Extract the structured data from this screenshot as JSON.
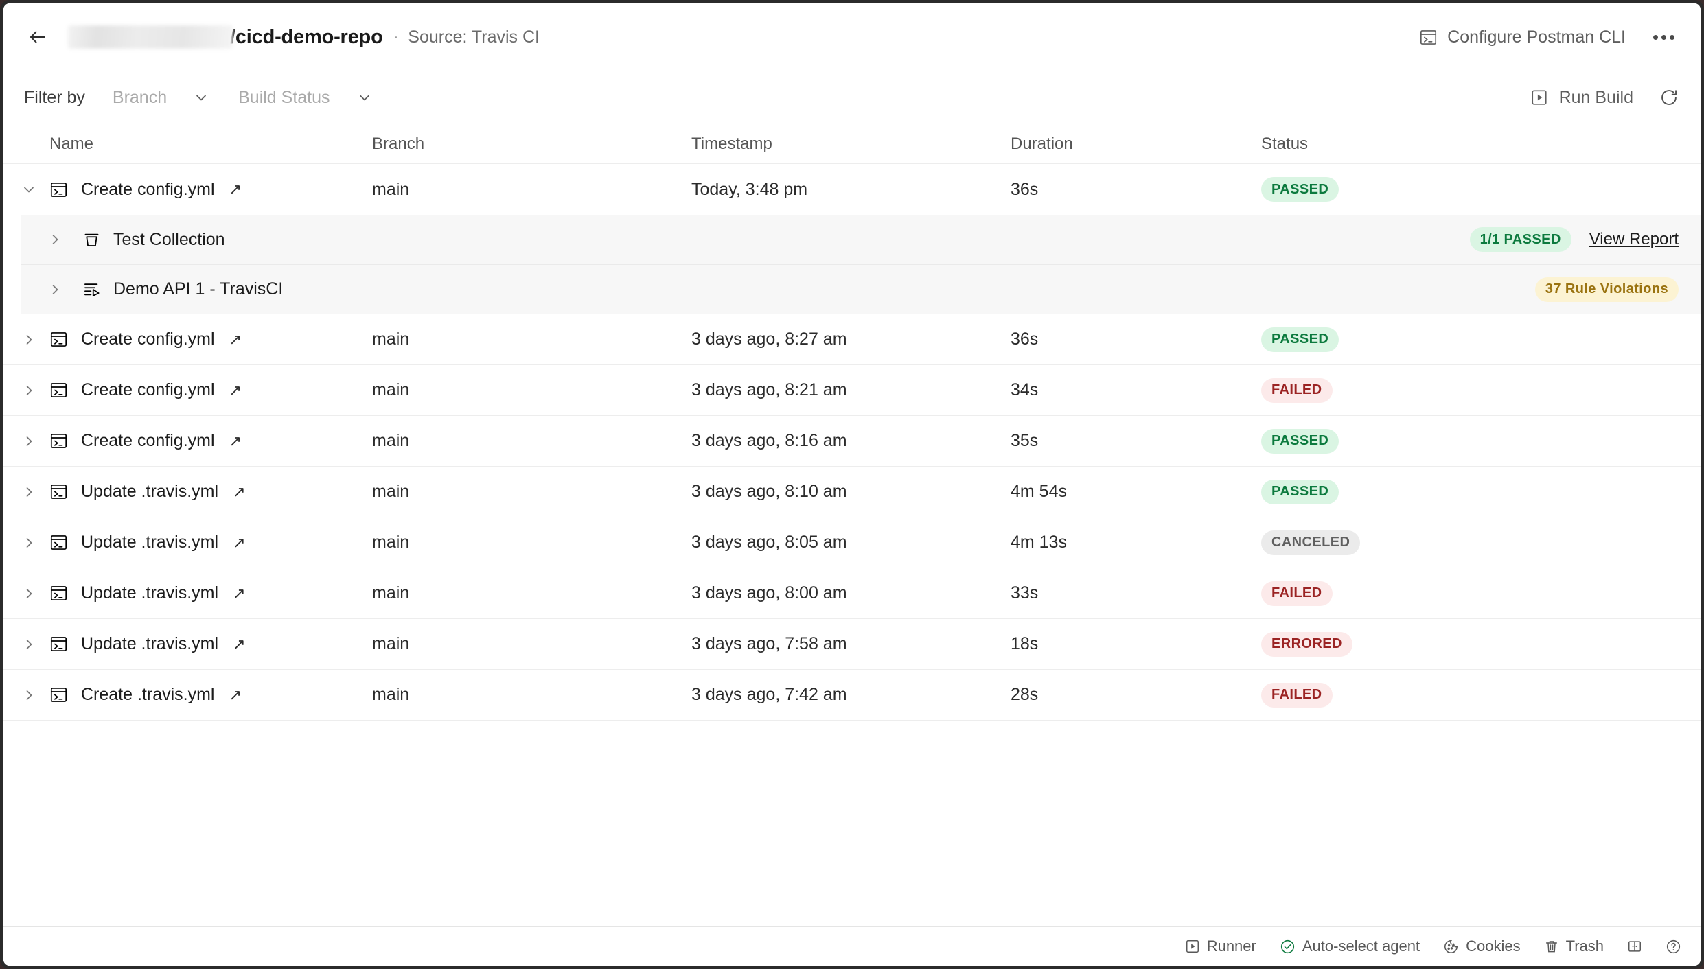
{
  "header": {
    "back_icon": "arrow-left-icon",
    "owner_redacted": "",
    "repo": "/cicd-demo-repo",
    "separator": "·",
    "source": "Source: Travis CI",
    "configure_cli_label": "Configure Postman CLI",
    "configure_cli_icon": "terminal-icon",
    "more_icon": "more-horizontal-icon"
  },
  "filterbar": {
    "filter_by_label": "Filter by",
    "branch_placeholder": "Branch",
    "status_placeholder": "Build Status",
    "chevron_icon": "chevron-down-icon",
    "run_build_label": "Run Build",
    "run_build_icon": "play-square-icon",
    "refresh_icon": "refresh-icon"
  },
  "table": {
    "columns": {
      "name": "Name",
      "branch": "Branch",
      "timestamp": "Timestamp",
      "duration": "Duration",
      "status": "Status"
    },
    "rows": [
      {
        "name": "Create config.yml",
        "icon": "terminal-icon",
        "external_link_icon": "↗",
        "branch": "main",
        "timestamp": "Today, 3:48 pm",
        "duration": "36s",
        "status": "PASSED",
        "status_kind": "passed",
        "expanded": true,
        "children": [
          {
            "name": "Test Collection",
            "icon": "collection-icon",
            "badge": "1/1 PASSED",
            "badge_kind": "passed",
            "link": "View Report"
          },
          {
            "name": "Demo API 1 - TravisCI",
            "icon": "api-icon",
            "badge": "37 Rule Violations",
            "badge_kind": "warn",
            "link": ""
          }
        ]
      },
      {
        "name": "Create config.yml",
        "icon": "terminal-icon",
        "external_link_icon": "↗",
        "branch": "main",
        "timestamp": "3 days ago, 8:27 am",
        "duration": "36s",
        "status": "PASSED",
        "status_kind": "passed",
        "expanded": false
      },
      {
        "name": "Create config.yml",
        "icon": "terminal-icon",
        "external_link_icon": "↗",
        "branch": "main",
        "timestamp": "3 days ago, 8:21 am",
        "duration": "34s",
        "status": "FAILED",
        "status_kind": "failed",
        "expanded": false
      },
      {
        "name": "Create config.yml",
        "icon": "terminal-icon",
        "external_link_icon": "↗",
        "branch": "main",
        "timestamp": "3 days ago, 8:16 am",
        "duration": "35s",
        "status": "PASSED",
        "status_kind": "passed",
        "expanded": false
      },
      {
        "name": "Update .travis.yml",
        "icon": "terminal-icon",
        "external_link_icon": "↗",
        "branch": "main",
        "timestamp": "3 days ago, 8:10 am",
        "duration": "4m 54s",
        "status": "PASSED",
        "status_kind": "passed",
        "expanded": false
      },
      {
        "name": "Update .travis.yml",
        "icon": "terminal-icon",
        "external_link_icon": "↗",
        "branch": "main",
        "timestamp": "3 days ago, 8:05 am",
        "duration": "4m 13s",
        "status": "CANCELED",
        "status_kind": "canceled",
        "expanded": false
      },
      {
        "name": "Update .travis.yml",
        "icon": "terminal-icon",
        "external_link_icon": "↗",
        "branch": "main",
        "timestamp": "3 days ago, 8:00 am",
        "duration": "33s",
        "status": "FAILED",
        "status_kind": "failed",
        "expanded": false
      },
      {
        "name": "Update .travis.yml",
        "icon": "terminal-icon",
        "external_link_icon": "↗",
        "branch": "main",
        "timestamp": "3 days ago, 7:58 am",
        "duration": "18s",
        "status": "ERRORED",
        "status_kind": "errored",
        "expanded": false
      },
      {
        "name": "Create .travis.yml",
        "icon": "terminal-icon",
        "external_link_icon": "↗",
        "branch": "main",
        "timestamp": "3 days ago, 7:42 am",
        "duration": "28s",
        "status": "FAILED",
        "status_kind": "failed",
        "expanded": false
      }
    ]
  },
  "statusbar": {
    "items": [
      {
        "label": "Runner",
        "icon": "play-square-icon"
      },
      {
        "label": "Auto-select agent",
        "icon": "check-circle-icon"
      },
      {
        "label": "Cookies",
        "icon": "cookie-icon"
      },
      {
        "label": "Trash",
        "icon": "trash-icon"
      },
      {
        "label": "",
        "icon": "layout-panel-icon"
      },
      {
        "label": "",
        "icon": "help-circle-icon"
      }
    ]
  },
  "colors": {
    "passed_text": "#0c7a3e",
    "passed_bg": "#daf5e3",
    "failed_text": "#9b2323",
    "failed_bg": "#fceaea",
    "canceled_text": "#5f5f5f",
    "canceled_bg": "#ebebeb",
    "warn_text": "#9a7310",
    "warn_bg": "#fcf3d3"
  }
}
